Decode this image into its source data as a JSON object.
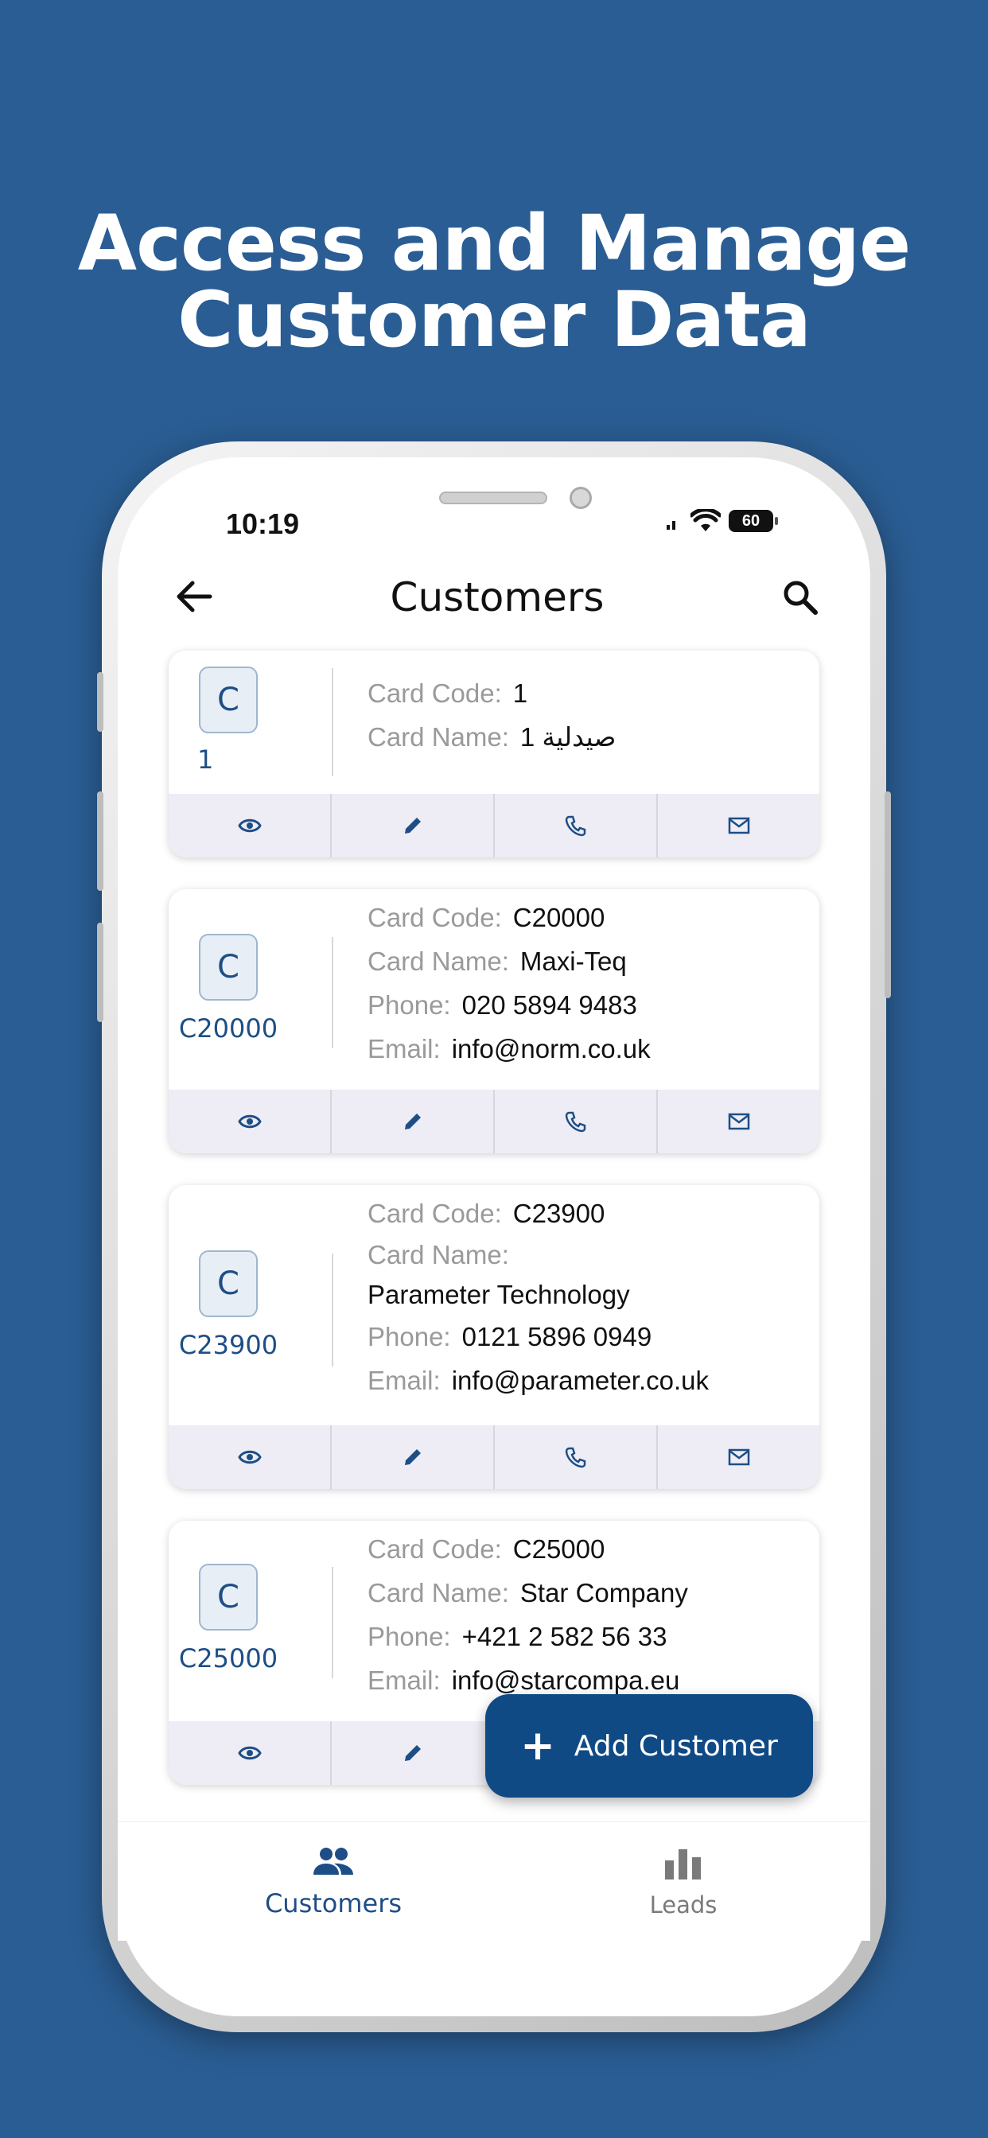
{
  "headline": {
    "line1": "Access and Manage",
    "line2": "Customer Data"
  },
  "status_bar": {
    "time": "10:19",
    "battery": "60"
  },
  "app_bar": {
    "title": "Customers"
  },
  "labels": {
    "card_code": "Card Code:",
    "card_name": "Card Name:",
    "phone": "Phone:",
    "email": "Email:"
  },
  "customers": [
    {
      "avatar": "C",
      "code": "1",
      "name": "صيدلية 1",
      "phone": "",
      "email": ""
    },
    {
      "avatar": "C",
      "code": "C20000",
      "name": "Maxi-Teq",
      "phone": "020 5894 9483",
      "email": "info@norm.co.uk"
    },
    {
      "avatar": "C",
      "code": "C23900",
      "name": "Parameter Technology",
      "phone": "0121 5896 0949",
      "email": "info@parameter.co.uk"
    },
    {
      "avatar": "C",
      "code": "C25000",
      "name": "Star Company",
      "phone": "+421 2 582 56 33",
      "email": "info@starcompa.eu"
    }
  ],
  "card_actions": [
    "view-icon",
    "edit-icon",
    "phone-icon",
    "mail-icon"
  ],
  "fab": {
    "label": "Add Customer"
  },
  "bottom_nav": {
    "items": [
      {
        "label": "Customers",
        "icon": "people-icon",
        "active": true
      },
      {
        "label": "Leads",
        "icon": "bar-chart-icon",
        "active": false
      }
    ]
  },
  "colors": {
    "background": "#2a5d93",
    "primary": "#0f4a85",
    "accent_text": "#1e4e86",
    "action_bar": "#eeedf5"
  }
}
